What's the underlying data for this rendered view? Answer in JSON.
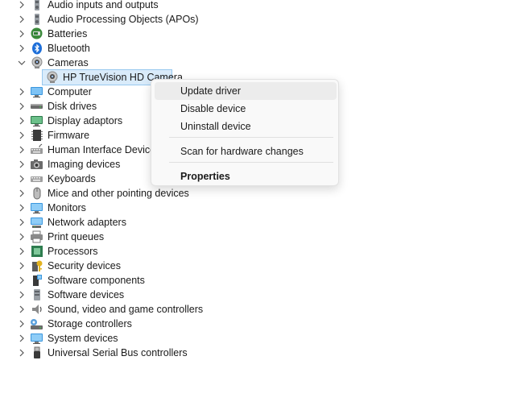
{
  "tree": {
    "categories": [
      {
        "label": "Audio inputs and outputs",
        "icon": "speaker-icon",
        "expanded": false
      },
      {
        "label": "Audio Processing Objects (APOs)",
        "icon": "speaker-icon",
        "expanded": false
      },
      {
        "label": "Batteries",
        "icon": "battery-icon",
        "expanded": false
      },
      {
        "label": "Bluetooth",
        "icon": "bluetooth-icon",
        "expanded": false
      },
      {
        "label": "Cameras",
        "icon": "camera-icon",
        "expanded": true
      },
      {
        "label": "Computer",
        "icon": "computer-icon",
        "expanded": false
      },
      {
        "label": "Disk drives",
        "icon": "disk-drive-icon",
        "expanded": false
      },
      {
        "label": "Display adaptors",
        "icon": "display-adapter-icon",
        "expanded": false
      },
      {
        "label": "Firmware",
        "icon": "firmware-icon",
        "expanded": false
      },
      {
        "label": "Human Interface Devices",
        "icon": "hid-icon",
        "expanded": false
      },
      {
        "label": "Imaging devices",
        "icon": "imaging-device-icon",
        "expanded": false
      },
      {
        "label": "Keyboards",
        "icon": "keyboard-icon",
        "expanded": false
      },
      {
        "label": "Mice and other pointing devices",
        "icon": "mouse-icon",
        "expanded": false
      },
      {
        "label": "Monitors",
        "icon": "monitor-icon",
        "expanded": false
      },
      {
        "label": "Network adapters",
        "icon": "network-adapter-icon",
        "expanded": false
      },
      {
        "label": "Print queues",
        "icon": "printer-icon",
        "expanded": false
      },
      {
        "label": "Processors",
        "icon": "processor-icon",
        "expanded": false
      },
      {
        "label": "Security devices",
        "icon": "security-device-icon",
        "expanded": false
      },
      {
        "label": "Software components",
        "icon": "software-component-icon",
        "expanded": false
      },
      {
        "label": "Software devices",
        "icon": "software-device-icon",
        "expanded": false
      },
      {
        "label": "Sound, video and game controllers",
        "icon": "sound-controller-icon",
        "expanded": false
      },
      {
        "label": "Storage controllers",
        "icon": "storage-controller-icon",
        "expanded": false
      },
      {
        "label": "System devices",
        "icon": "system-device-icon",
        "expanded": false
      },
      {
        "label": "Universal Serial Bus controllers",
        "icon": "usb-icon",
        "expanded": false
      }
    ],
    "camera_child": {
      "label": "HP TrueVision HD Camera",
      "icon": "webcam-icon",
      "selected": true
    }
  },
  "context_menu": {
    "items": [
      {
        "label": "Update driver",
        "highlighted": true
      },
      {
        "label": "Disable device"
      },
      {
        "label": "Uninstall device"
      },
      {
        "label": "Scan for hardware changes"
      },
      {
        "label": "Properties",
        "bold": true
      }
    ]
  },
  "colors": {
    "selection_bg": "#d9ebfa",
    "selection_border": "#99c9ef",
    "menu_bg": "#f9f9f9",
    "menu_hover": "#ececec"
  }
}
